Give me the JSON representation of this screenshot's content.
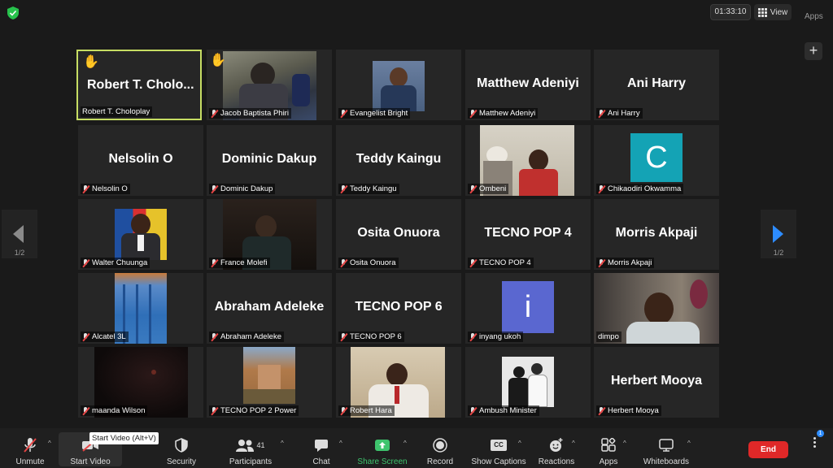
{
  "timer": "01:33:10",
  "view_label": "View",
  "apps_top_label": "Apps",
  "page_indicator": "1/2",
  "tooltip": "Start Video (Alt+V)",
  "participants_count": "41",
  "tiles": [
    {
      "big": "Robert T. Cholo...",
      "label": "Robert T. Choloplay"
    },
    {
      "big": "",
      "label": "Jacob Baptista Phiri"
    },
    {
      "big": "",
      "label": "Evangelist Bright"
    },
    {
      "big": "Matthew Adeniyi",
      "label": "Matthew Adeniyi"
    },
    {
      "big": "Ani Harry",
      "label": "Ani Harry"
    },
    {
      "big": "Nelsolin O",
      "label": "Nelsolin O"
    },
    {
      "big": "Dominic Dakup",
      "label": "Dominic Dakup"
    },
    {
      "big": "Teddy Kaingu",
      "label": "Teddy Kaingu"
    },
    {
      "big": "",
      "label": "Ombeni"
    },
    {
      "big": "",
      "label": "Chikaodiri Okwamma",
      "avatar": "C"
    },
    {
      "big": "",
      "label": "Walter Chuunga"
    },
    {
      "big": "",
      "label": "France Molefi"
    },
    {
      "big": "Osita Onuora",
      "label": "Osita Onuora"
    },
    {
      "big": "TECNO POP 4",
      "label": "TECNO POP 4"
    },
    {
      "big": "Morris Akpaji",
      "label": "Morris Akpaji"
    },
    {
      "big": "",
      "label": "Alcatel 3L"
    },
    {
      "big": "Abraham Adeleke",
      "label": "Abraham Adeleke"
    },
    {
      "big": "TECNO POP 6",
      "label": "TECNO POP 6"
    },
    {
      "big": "",
      "label": "inyang ukoh",
      "avatar": "i"
    },
    {
      "big": "",
      "label": "dimpo"
    },
    {
      "big": "",
      "label": "maanda Wilson"
    },
    {
      "big": "",
      "label": "TECNO POP 2 Power"
    },
    {
      "big": "",
      "label": "Robert Hara"
    },
    {
      "big": "",
      "label": "Ambush Minister"
    },
    {
      "big": "Herbert Mooya",
      "label": "Herbert Mooya"
    }
  ],
  "toolbar": {
    "unmute": "Unmute",
    "start_video": "Start Video",
    "security": "Security",
    "participants": "Participants",
    "chat": "Chat",
    "share_screen": "Share Screen",
    "record": "Record",
    "show_captions": "Show Captions",
    "reactions": "Reactions",
    "apps": "Apps",
    "whiteboards": "Whiteboards",
    "end": "End",
    "cc": "CC",
    "notification_count": "1"
  },
  "colors": {
    "active_speaker_border": "#c6dd63",
    "end_button": "#e02828",
    "share_screen": "#3ec46d",
    "next_arrow": "#2d8cff",
    "avatar_c": "#14a3b5",
    "avatar_i": "#5a67d0"
  }
}
